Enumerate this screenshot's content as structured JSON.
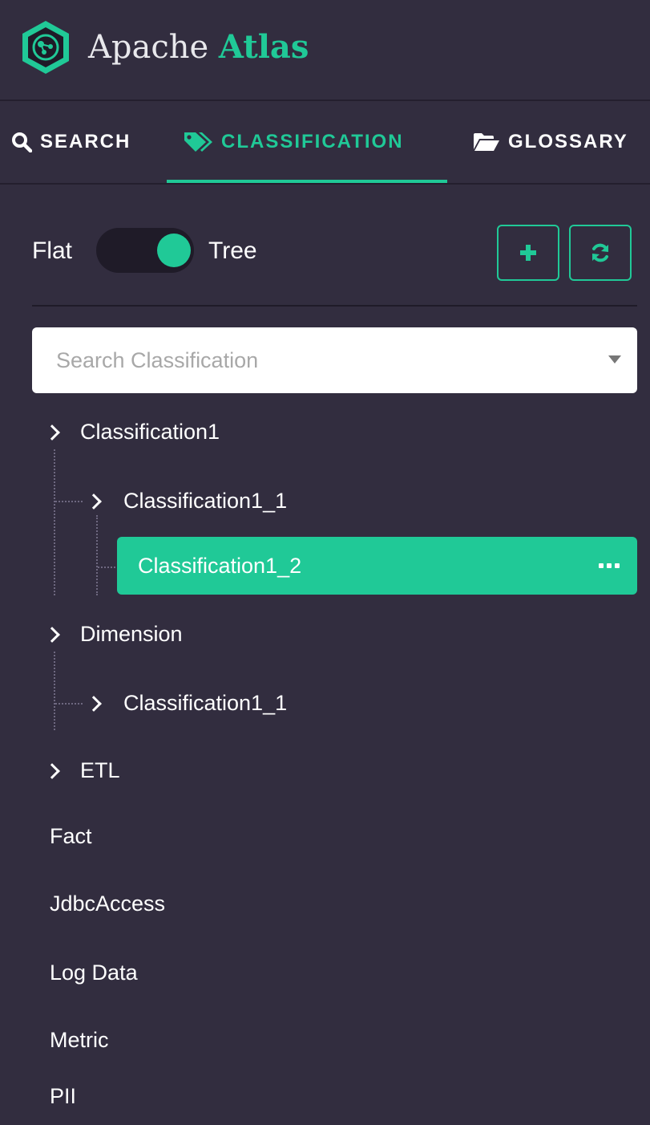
{
  "app": {
    "title_part1": "Apache",
    "title_part2": "Atlas",
    "accent_color": "#20c997",
    "background_color": "#322d3f"
  },
  "tabs": [
    {
      "label": "SEARCH",
      "icon": "search-icon",
      "active": false
    },
    {
      "label": "CLASSIFICATION",
      "icon": "tags-icon",
      "active": true
    },
    {
      "label": "GLOSSARY",
      "icon": "folder-open-icon",
      "active": false
    }
  ],
  "view_toggle": {
    "left_label": "Flat",
    "right_label": "Tree",
    "selected": "Tree"
  },
  "actions": {
    "add_icon": "plus-icon",
    "refresh_icon": "refresh-icon"
  },
  "search": {
    "placeholder": "Search Classification",
    "value": ""
  },
  "tree": {
    "items": [
      {
        "label": "Classification1"
      },
      {
        "label": "Classification1_1"
      },
      {
        "label": "Classification1_2",
        "selected": true
      },
      {
        "label": "Dimension"
      },
      {
        "label": "Classification1_1"
      },
      {
        "label": "ETL"
      },
      {
        "label": "Fact"
      },
      {
        "label": "JdbcAccess"
      },
      {
        "label": "Log Data"
      },
      {
        "label": "Metric"
      },
      {
        "label": "PII"
      }
    ]
  }
}
